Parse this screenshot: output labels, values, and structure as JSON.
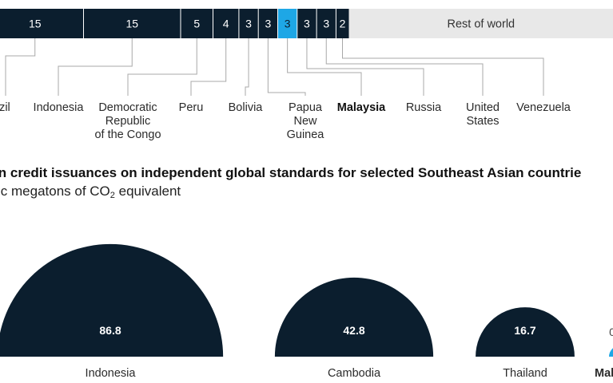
{
  "colors": {
    "dark": "#0b1e2e",
    "highlight": "#1ea7e6",
    "rest": "#e8e8e8",
    "connector": "#a8a8a8"
  },
  "chart_data": [
    {
      "type": "bar",
      "orientation": "horizontal-stacked",
      "categories": [
        "azil",
        "Indonesia",
        "Democratic Republic of the Congo",
        "Peru",
        "Bolivia",
        "Papua New Guinea",
        "Malaysia",
        "Russia",
        "United States",
        "Venezuela",
        "Rest of world"
      ],
      "values": [
        15,
        15,
        5,
        4,
        3,
        3,
        3,
        3,
        3,
        2
      ],
      "value_labels": [
        "15",
        "15",
        "5",
        "4",
        "3",
        "3",
        "3",
        "3",
        "3",
        "2"
      ],
      "highlight": "Malaysia",
      "rest_label": "Rest of world",
      "labels": [
        {
          "text": "azil",
          "bold": false
        },
        {
          "text": "Indonesia",
          "bold": false
        },
        {
          "text": "Democratic\nRepublic\nof the Congo",
          "bold": false
        },
        {
          "text": "Peru",
          "bold": false
        },
        {
          "text": "Bolivia",
          "bold": false
        },
        {
          "text": "Papua\nNew\nGuinea",
          "bold": false
        },
        {
          "text": "Malaysia",
          "bold": true
        },
        {
          "text": "Russia",
          "bold": false
        },
        {
          "text": "United\nStates",
          "bold": false
        },
        {
          "text": "Venezuela",
          "bold": false
        }
      ]
    },
    {
      "type": "bubble",
      "title": "bon credit issuances on independent global standards for selected Southeast Asian countrie",
      "subtitle_prefix": "ic megatons of CO",
      "subtitle_sub": "2",
      "subtitle_suffix": " equivalent",
      "categories": [
        "Indonesia",
        "Cambodia",
        "Thailand",
        "Mal"
      ],
      "values": [
        86.8,
        42.8,
        16.7,
        null
      ],
      "value_labels": [
        "86.8",
        "42.8",
        "16.7",
        "0"
      ],
      "highlight": "Mal"
    }
  ]
}
